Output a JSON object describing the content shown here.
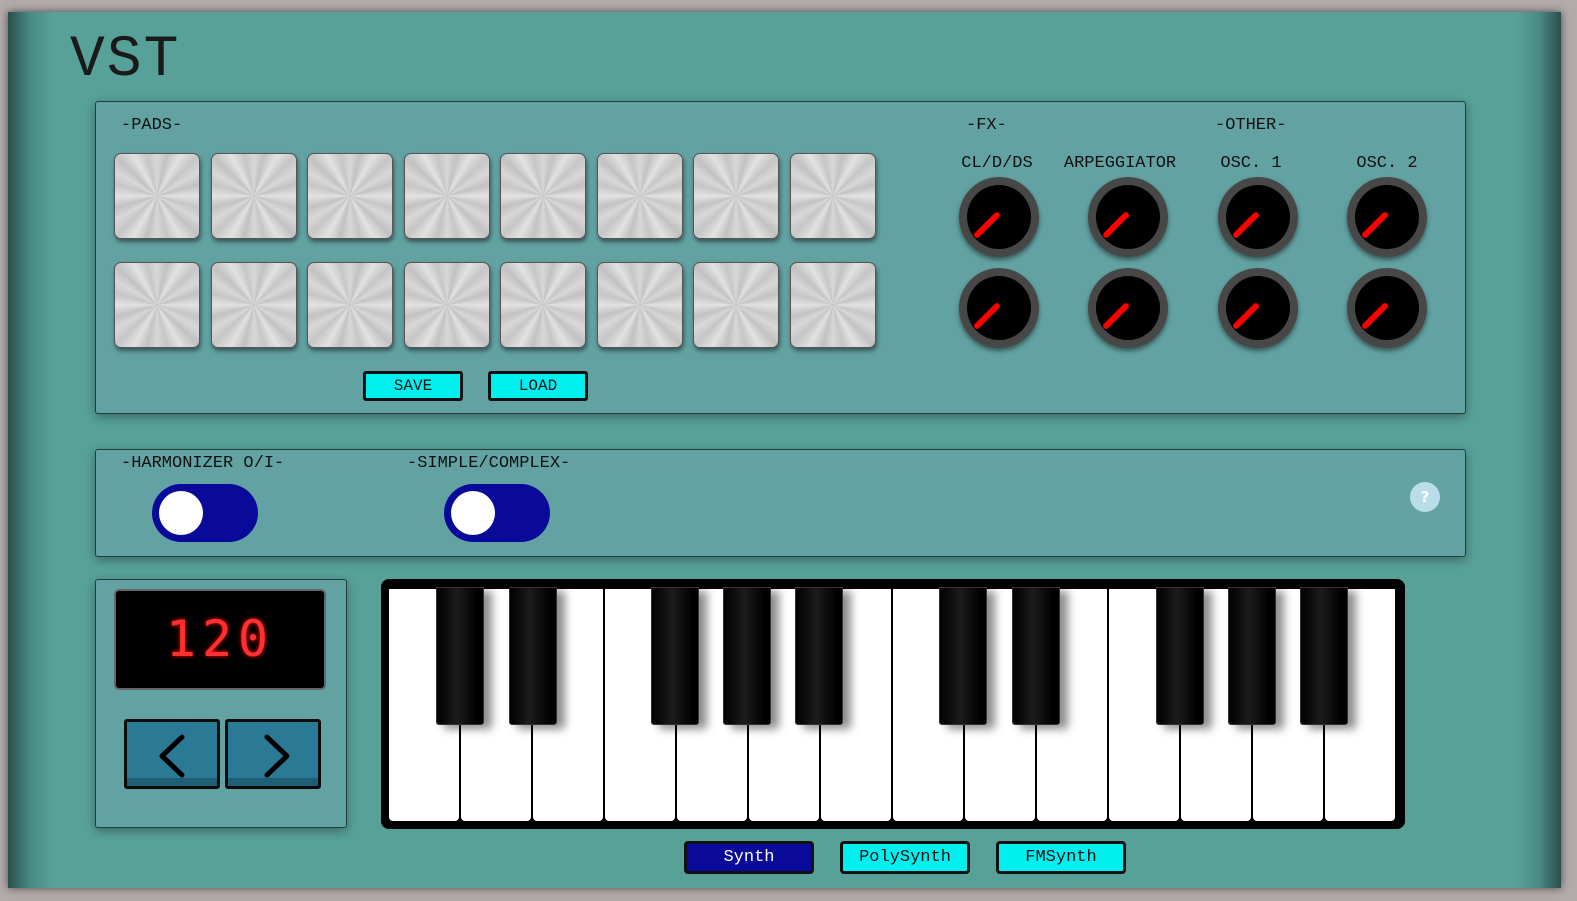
{
  "app": {
    "title": "VST"
  },
  "pads_section": {
    "label": "-PADS-",
    "save_label": "SAVE",
    "load_label": "LOAD",
    "pad_count": 16
  },
  "fx_section": {
    "label": "-FX-",
    "knob_labels": [
      "CL/D/DS",
      "ARPEGGIATOR"
    ]
  },
  "other_section": {
    "label": "-OTHER-",
    "knob_labels": [
      "OSC. 1",
      "OSC. 2"
    ]
  },
  "harmonizer": {
    "label": "-HARMONIZER O/I-",
    "state": "off"
  },
  "simple_complex": {
    "label": "-SIMPLE/COMPLEX-",
    "state": "off"
  },
  "help": {
    "label": "?"
  },
  "tempo": {
    "value": "120"
  },
  "synth_selector": {
    "options": [
      "Synth",
      "PolySynth",
      "FMSynth"
    ],
    "selected": "Synth"
  },
  "colors": {
    "panel": "#63a2a2",
    "button": "#00f0f0",
    "selected_button": "#0a0a9a",
    "knob_needle": "#ff0000",
    "display_text": "#ff3030"
  }
}
